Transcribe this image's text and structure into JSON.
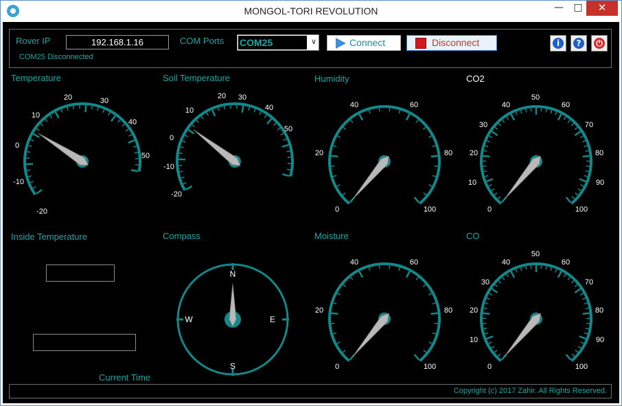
{
  "window": {
    "title": "MONGOL-TORI REVOLUTION"
  },
  "controls": {
    "rover_ip_label": "Rover IP",
    "rover_ip_value": "192.168.1.16",
    "com_ports_label": "COM Ports",
    "com_port_selected": "COM25",
    "connect_label": "Connect",
    "disconnect_label": "Disconnect",
    "status_text": "COM25 Disconnected"
  },
  "gauges": {
    "temperature": {
      "title": "Temperature",
      "ticks": [
        "-20",
        "-10",
        "0",
        "10",
        "20",
        "30",
        "40",
        "50"
      ],
      "value": 1
    },
    "soil_temperature": {
      "title": "Soil Temperature",
      "ticks": [
        "-20",
        "-10",
        "0",
        "10",
        "20",
        "30",
        "40",
        "50"
      ],
      "value": 1
    },
    "humidity": {
      "title": "Humidity",
      "ticks": [
        "0",
        "20",
        "40",
        "60",
        "80",
        "100"
      ],
      "value": 0
    },
    "co2": {
      "title": "CO2",
      "ticks": [
        "0",
        "10",
        "20",
        "30",
        "40",
        "50",
        "60",
        "70",
        "80",
        "90",
        "100"
      ],
      "value": 0
    },
    "moisture": {
      "title": "Moisture",
      "ticks": [
        "0",
        "20",
        "40",
        "60",
        "80",
        "100"
      ],
      "value": 0
    },
    "co": {
      "title": "CO",
      "ticks": [
        "0",
        "10",
        "20",
        "30",
        "40",
        "50",
        "60",
        "70",
        "80",
        "90",
        "100"
      ],
      "value": 0
    }
  },
  "inside_temperature": {
    "title": "Inside Temperature"
  },
  "compass": {
    "title": "Compass",
    "n": "N",
    "e": "E",
    "s": "S",
    "w": "W",
    "heading": 0
  },
  "current_time_label": "Current Time",
  "footer": {
    "copyright": "Copyright (c) 2017 Zahir. All Rights Reserved."
  },
  "colors": {
    "accent": "#1aa7a7",
    "gauge_arc": "#11898b",
    "background": "#000000",
    "needle": "#b9b9b9"
  },
  "icons": {
    "app": "app-icon",
    "connect": "play-icon",
    "disconnect": "stop-icon",
    "info": "info-icon",
    "help": "help-icon",
    "power": "power-icon"
  }
}
